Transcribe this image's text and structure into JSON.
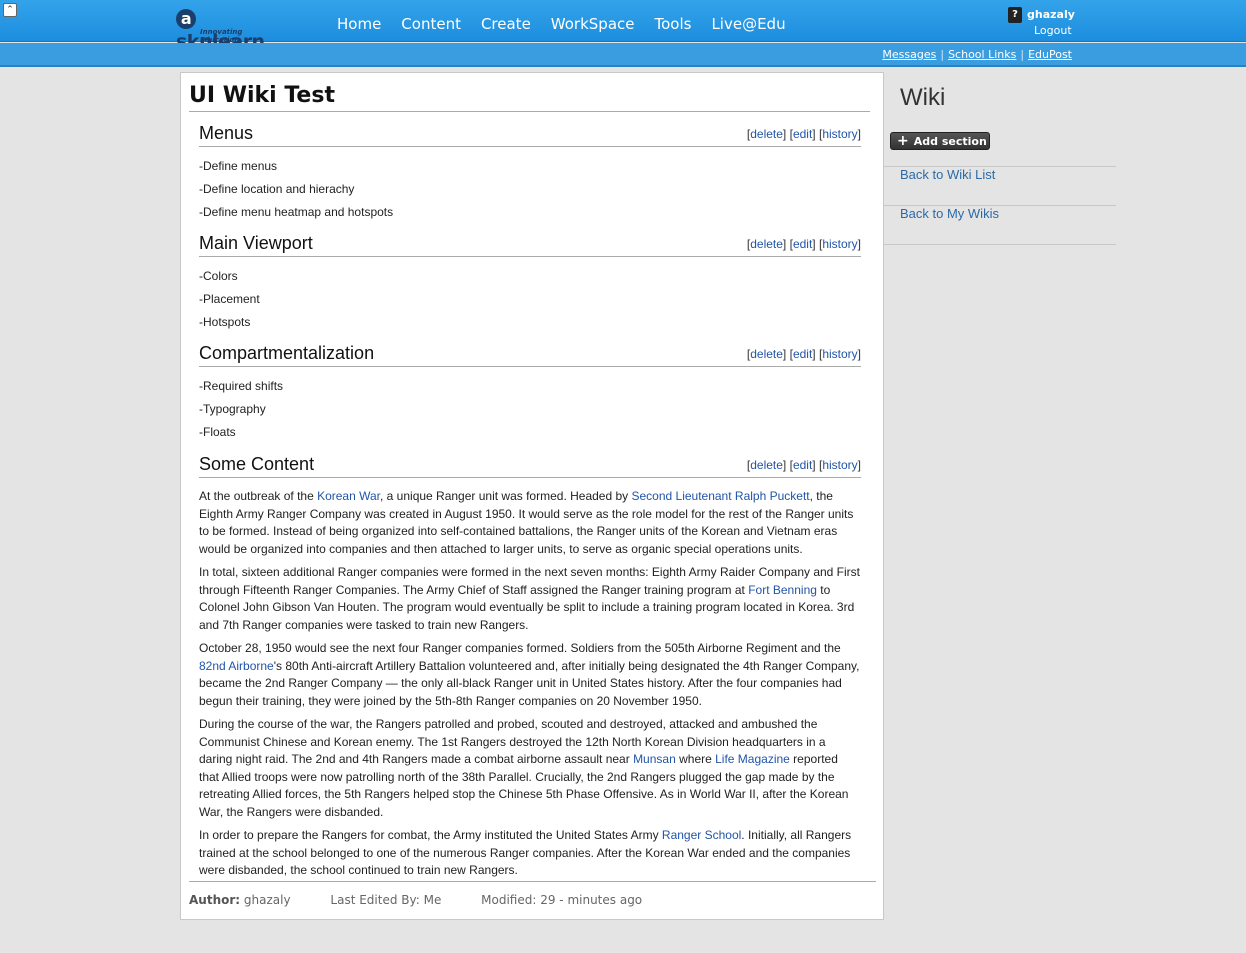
{
  "topbar": {
    "collapse_icon": "collapse-up-icon",
    "logo_main": "sknlearn",
    "logo_letter": "a",
    "logo_sub": "Innovating Education",
    "nav": [
      "Home",
      "Content",
      "Create",
      "WorkSpace",
      "Tools",
      "Live@Edu"
    ],
    "user_avatar_glyph": "?",
    "user_name": "ghazaly",
    "logout": "Logout"
  },
  "subbar": {
    "links": [
      "Messages",
      "School Links",
      "EduPost"
    ],
    "separator": "|"
  },
  "page": {
    "title": "UI Wiki Test",
    "action_labels": {
      "delete": "delete",
      "edit": "edit",
      "history": "history"
    },
    "sections": [
      {
        "title": "Menus",
        "lines": [
          "-Define menus",
          "-Define location and hierachy",
          "-Define menu heatmap and hotspots"
        ]
      },
      {
        "title": "Main Viewport",
        "lines": [
          "-Colors",
          "-Placement",
          "-Hotspots"
        ]
      },
      {
        "title": "Compartmentalization",
        "lines": [
          "-Required shifts",
          "-Typography",
          "-Floats"
        ]
      },
      {
        "title": "Some Content"
      }
    ],
    "content": {
      "p1": {
        "t1": "At the outbreak of the ",
        "l1": "Korean War",
        "t2": ", a unique Ranger unit was formed. Headed by ",
        "l2": "Second Lieutenant Ralph Puckett",
        "t3": ", the Eighth Army Ranger Company was created in August 1950. It would serve as the role model for the rest of the Ranger units to be formed. Instead of being organized into self-contained battalions, the Ranger units of the Korean and Vietnam eras would be organized into companies and then attached to larger units, to serve as organic special operations units."
      },
      "p2": {
        "t1": "In total, sixteen additional Ranger companies were formed in the next seven months: Eighth Army Raider Company and First through Fifteenth Ranger Companies. The Army Chief of Staff assigned the Ranger training program at ",
        "l1": "Fort Benning",
        "t2": " to Colonel John Gibson Van Houten. The program would eventually be split to include a training program located in Korea. 3rd and 7th Ranger companies were tasked to train new Rangers."
      },
      "p3": {
        "t1": "October 28, 1950 would see the next four Ranger companies formed. Soldiers from the 505th Airborne Regiment and the ",
        "l1": "82nd Airborne",
        "t2": "'s 80th Anti-aircraft Artillery Battalion volunteered and, after initially being designated the 4th Ranger Company, became the 2nd Ranger Company — the only all-black Ranger unit in United States history. After the four companies had begun their training, they were joined by the 5th-8th Ranger companies on 20 November 1950."
      },
      "p4": {
        "t1": "During the course of the war, the Rangers patrolled and probed, scouted and destroyed, attacked and ambushed the Communist Chinese and Korean enemy. The 1st Rangers destroyed the 12th North Korean Division headquarters in a daring night raid. The 2nd and 4th Rangers made a combat airborne assault near ",
        "l1": "Munsan",
        "t2": " where ",
        "l2": "Life Magazine",
        "t3": " reported that Allied troops were now patrolling north of the 38th Parallel. Crucially, the 2nd Rangers plugged the gap made by the retreating Allied forces, the 5th Rangers helped stop the Chinese 5th Phase Offensive. As in World War II, after the Korean War, the Rangers were disbanded."
      },
      "p5": {
        "t1": "In order to prepare the Rangers for combat, the Army instituted the United States Army ",
        "l1": "Ranger School",
        "t2": ". Initially, all Rangers trained at the school belonged to one of the numerous Ranger companies. After the Korean War ended and the companies were disbanded, the school continued to train new Rangers."
      }
    },
    "footer": {
      "author_label": "Author:",
      "author": "ghazaly",
      "last_edited": "Last Edited By: Me",
      "modified": "Modified: 29 - minutes ago"
    }
  },
  "sidebar": {
    "title": "Wiki",
    "add_section": "Add section",
    "add_icon": "plus-icon",
    "links": [
      "Back to Wiki List",
      "Back to My Wikis"
    ]
  },
  "colors": {
    "topbar_blue": "#1d8ede",
    "link_blue": "#2155a8",
    "sidebar_link": "#2a6aa8"
  }
}
